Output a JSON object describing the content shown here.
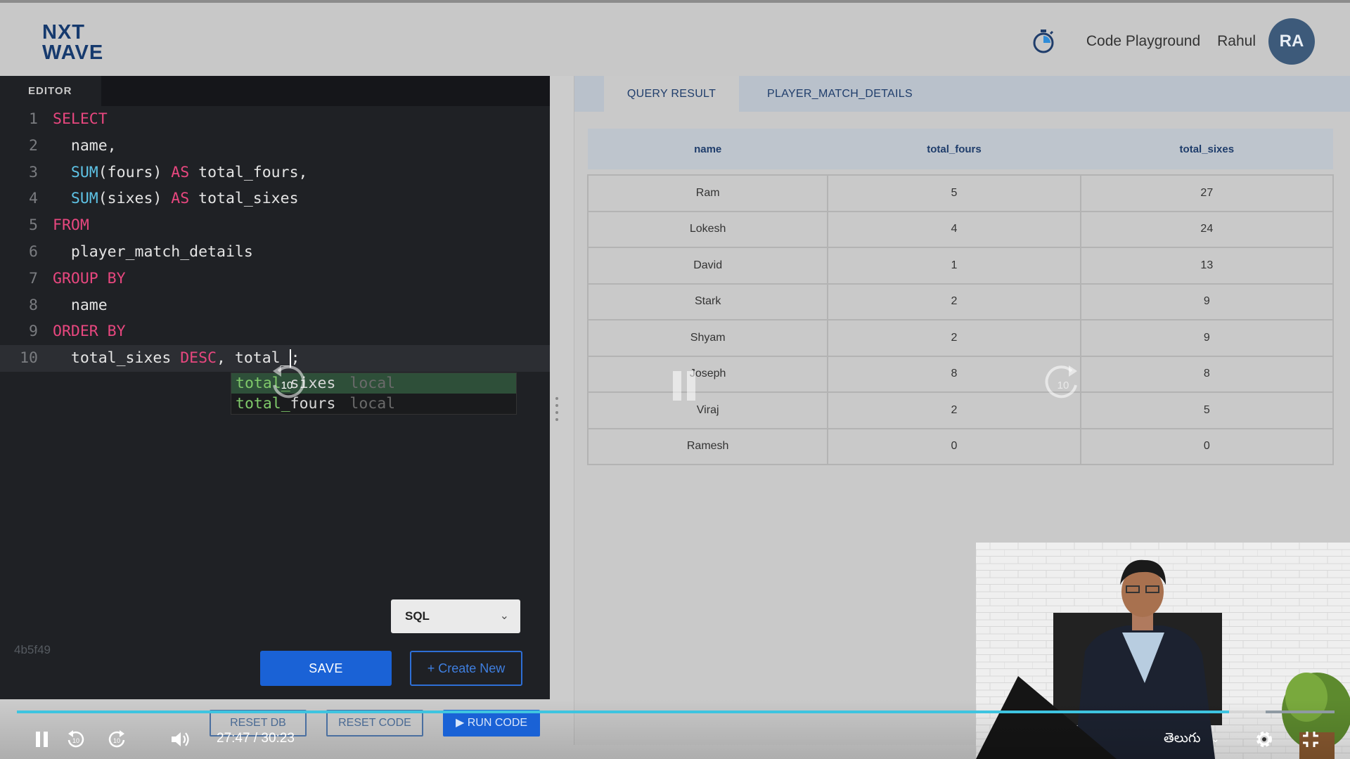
{
  "header": {
    "logo_line1": "NXT",
    "logo_line2": "WAVE",
    "code_playground": "Code Playground",
    "user_name": "Rahul",
    "avatar_initials": "RA"
  },
  "editor": {
    "tab_label": "EDITOR",
    "line_numbers": [
      "1",
      "2",
      "3",
      "4",
      "5",
      "6",
      "7",
      "8",
      "9",
      "10"
    ],
    "lines": [
      [
        {
          "t": "SELECT",
          "k": "kw"
        }
      ],
      [
        {
          "t": "  name,",
          "k": "plain"
        }
      ],
      [
        {
          "t": "  ",
          "k": "plain"
        },
        {
          "t": "SUM",
          "k": "fn"
        },
        {
          "t": "(fours) ",
          "k": "plain"
        },
        {
          "t": "AS",
          "k": "kw"
        },
        {
          "t": " total_fours,",
          "k": "plain"
        }
      ],
      [
        {
          "t": "  ",
          "k": "plain"
        },
        {
          "t": "SUM",
          "k": "fn"
        },
        {
          "t": "(sixes) ",
          "k": "plain"
        },
        {
          "t": "AS",
          "k": "kw"
        },
        {
          "t": " total_sixes",
          "k": "plain"
        }
      ],
      [
        {
          "t": "FROM",
          "k": "kw"
        }
      ],
      [
        {
          "t": "  player_match_details",
          "k": "plain"
        }
      ],
      [
        {
          "t": "GROUP BY",
          "k": "kw"
        }
      ],
      [
        {
          "t": "  name",
          "k": "plain"
        }
      ],
      [
        {
          "t": "ORDER BY",
          "k": "kw"
        }
      ],
      [
        {
          "t": "  total_sixes ",
          "k": "plain"
        },
        {
          "t": "DESC",
          "k": "kw"
        },
        {
          "t": ", total_",
          "k": "plain"
        },
        {
          "t": "|",
          "k": "cursor"
        },
        {
          "t": ";",
          "k": "plain"
        }
      ]
    ],
    "autocomplete": [
      {
        "match": "total_",
        "rest": "sixes",
        "kind": "local",
        "selected": true
      },
      {
        "match": "total_",
        "rest": "fours",
        "kind": "local",
        "selected": false
      }
    ],
    "language": "SQL",
    "hash_text": "4b5f49",
    "save_label": "SAVE",
    "create_new_label": "Create New"
  },
  "results": {
    "tabs": [
      {
        "label": "QUERY RESULT",
        "active": true
      },
      {
        "label": "PLAYER_MATCH_DETAILS",
        "active": false
      }
    ],
    "columns": [
      "name",
      "total_fours",
      "total_sixes"
    ],
    "rows": [
      [
        "Ram",
        "5",
        "27"
      ],
      [
        "Lokesh",
        "4",
        "24"
      ],
      [
        "David",
        "1",
        "13"
      ],
      [
        "Stark",
        "2",
        "9"
      ],
      [
        "Shyam",
        "2",
        "9"
      ],
      [
        "Joseph",
        "8",
        "8"
      ],
      [
        "Viraj",
        "2",
        "5"
      ],
      [
        "Ramesh",
        "0",
        "0"
      ]
    ]
  },
  "bottom_buttons": {
    "reset_db": "RESET DB",
    "reset_code": "RESET CODE",
    "run_code": "RUN CODE"
  },
  "player": {
    "time_display": "27:47 / 30:23",
    "language": "తెలుగు",
    "progress": 0.92,
    "skip_seconds": "10",
    "progress_color": "#3ec4e0"
  }
}
